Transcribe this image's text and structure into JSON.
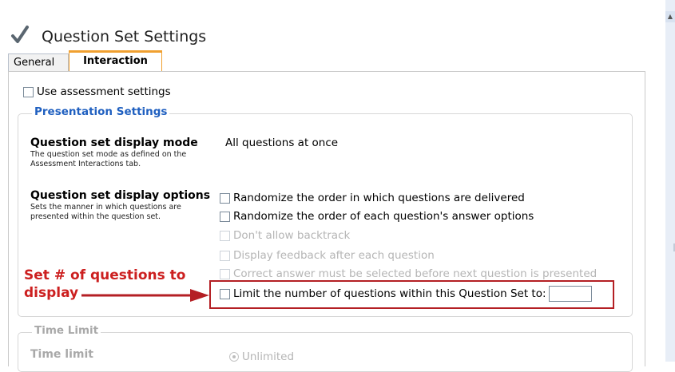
{
  "header": {
    "title": "Question Set Settings",
    "icon": "checkmark-icon"
  },
  "tabs": [
    {
      "label": "General",
      "active": false
    },
    {
      "label": "Interaction",
      "active": true
    }
  ],
  "use_assessment": {
    "label": "Use assessment settings",
    "checked": false
  },
  "presentation": {
    "legend": "Presentation Settings",
    "display_mode": {
      "title": "Question set display mode",
      "desc": "The question set mode as defined on the Assessment Interactions tab.",
      "value": "All questions at once"
    },
    "display_options": {
      "title": "Question set display options",
      "desc": "Sets the manner in which questions are presented within the question set.",
      "options": [
        {
          "label": "Randomize the order in which questions are delivered",
          "enabled": true,
          "checked": false
        },
        {
          "label": "Randomize the order of each question's answer options",
          "enabled": true,
          "checked": false
        },
        {
          "label": "Don't allow backtrack",
          "enabled": false,
          "checked": false
        },
        {
          "label": "Display feedback after each question",
          "enabled": false,
          "checked": false
        },
        {
          "label": "Correct answer must be selected before next question is presented",
          "enabled": false,
          "checked": false
        },
        {
          "label": "Limit the number of questions within this Question Set to:",
          "enabled": true,
          "checked": false
        }
      ],
      "limit_value": ""
    }
  },
  "callout": {
    "line1": "Set # of questions to",
    "line2": "display",
    "color": "#cc1f1f"
  },
  "time_limit": {
    "legend": "Time Limit",
    "title": "Time limit",
    "option": "Unlimited"
  },
  "colors": {
    "accent": "#f0a030",
    "legend_blue": "#2060c0",
    "callout_red": "#b41f24"
  }
}
